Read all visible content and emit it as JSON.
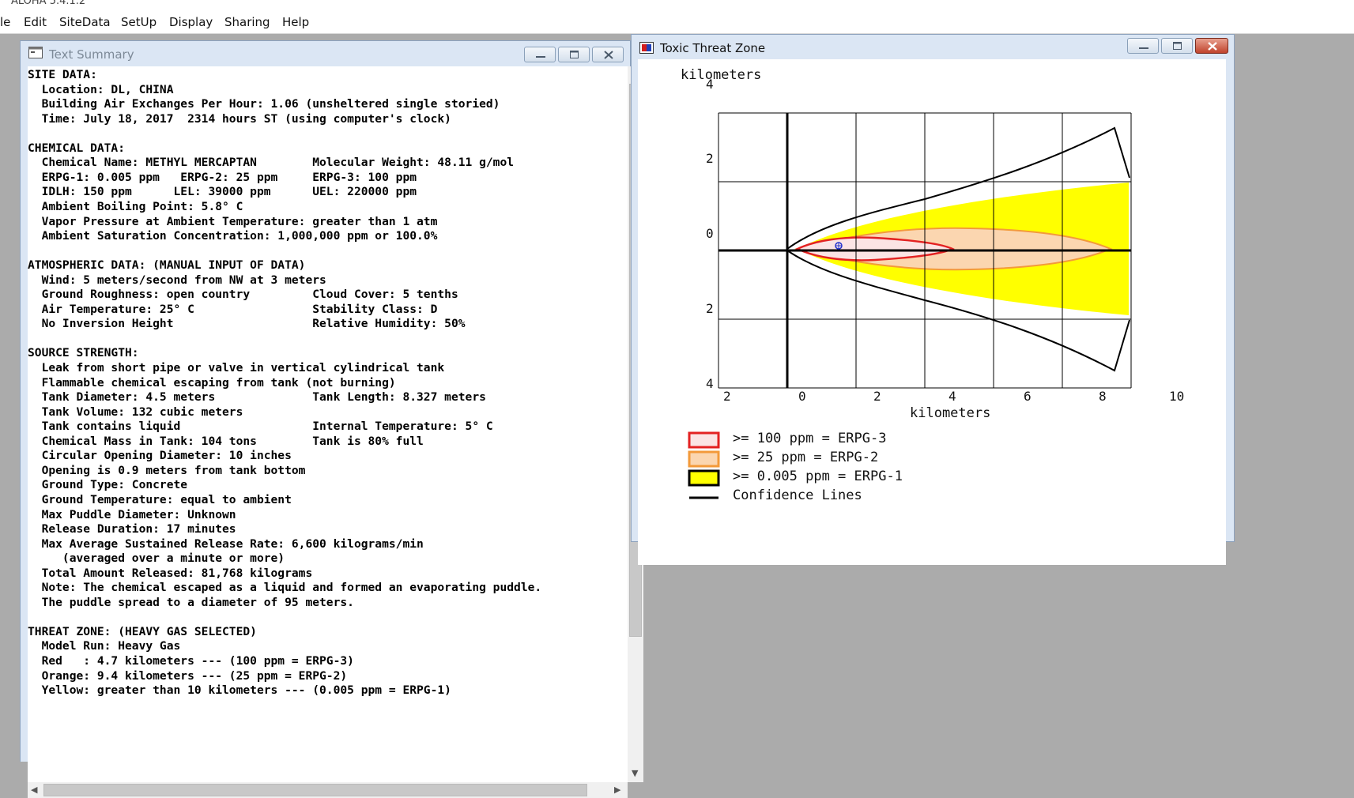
{
  "app": {
    "title": "ALOHA 5.4.1.2"
  },
  "menu": [
    "le",
    "Edit",
    "SiteData",
    "SetUp",
    "Display",
    "Sharing",
    "Help"
  ],
  "text_summary": {
    "title": "Text Summary",
    "lines": [
      "SITE DATA:",
      "  Location: DL, CHINA",
      "  Building Air Exchanges Per Hour: 1.06 (unsheltered single storied)",
      "  Time: July 18, 2017  2314 hours ST (using computer's clock)",
      "",
      "CHEMICAL DATA:",
      "  Chemical Name: METHYL MERCAPTAN        Molecular Weight: 48.11 g/mol",
      "  ERPG-1: 0.005 ppm   ERPG-2: 25 ppm     ERPG-3: 100 ppm",
      "  IDLH: 150 ppm      LEL: 39000 ppm      UEL: 220000 ppm",
      "  Ambient Boiling Point: 5.8° C",
      "  Vapor Pressure at Ambient Temperature: greater than 1 atm",
      "  Ambient Saturation Concentration: 1,000,000 ppm or 100.0%",
      "",
      "ATMOSPHERIC DATA: (MANUAL INPUT OF DATA)",
      "  Wind: 5 meters/second from NW at 3 meters",
      "  Ground Roughness: open country         Cloud Cover: 5 tenths",
      "  Air Temperature: 25° C                 Stability Class: D",
      "  No Inversion Height                    Relative Humidity: 50%",
      "",
      "SOURCE STRENGTH:",
      "  Leak from short pipe or valve in vertical cylindrical tank",
      "  Flammable chemical escaping from tank (not burning)",
      "  Tank Diameter: 4.5 meters              Tank Length: 8.327 meters",
      "  Tank Volume: 132 cubic meters",
      "  Tank contains liquid                   Internal Temperature: 5° C",
      "  Chemical Mass in Tank: 104 tons        Tank is 80% full",
      "  Circular Opening Diameter: 10 inches",
      "  Opening is 0.9 meters from tank bottom",
      "  Ground Type: Concrete",
      "  Ground Temperature: equal to ambient",
      "  Max Puddle Diameter: Unknown",
      "  Release Duration: 17 minutes",
      "  Max Average Sustained Release Rate: 6,600 kilograms/min",
      "     (averaged over a minute or more)",
      "  Total Amount Released: 81,768 kilograms",
      "  Note: The chemical escaped as a liquid and formed an evaporating puddle.",
      "  The puddle spread to a diameter of 95 meters.",
      "",
      "THREAT ZONE: (HEAVY GAS SELECTED)",
      "  Model Run: Heavy Gas",
      "  Red   : 4.7 kilometers --- (100 ppm = ERPG-3)",
      "  Orange: 9.4 kilometers --- (25 ppm = ERPG-2)",
      "  Yellow: greater than 10 kilometers --- (0.005 ppm = ERPG-1)"
    ]
  },
  "threat_zone": {
    "title": "Toxic Threat Zone",
    "ylabel": "kilometers",
    "xlabel": "kilometers",
    "x_ticks": [
      "2",
      "0",
      "2",
      "4",
      "6",
      "8",
      "10"
    ],
    "y_ticks": [
      "4",
      "2",
      "0",
      "2",
      "4"
    ],
    "legend": [
      {
        "label": ">= 100 ppm = ERPG-3",
        "color": "#e32222",
        "fill": "#fbe4e4"
      },
      {
        "label": ">= 25 ppm = ERPG-2",
        "color": "#f39a3a",
        "fill": "#fbd6b0"
      },
      {
        "label": ">= 0.005 ppm = ERPG-1",
        "color": "#000000",
        "fill": "#ffff00"
      },
      {
        "label": "Confidence Lines",
        "color": "#000000",
        "fill": "none"
      }
    ],
    "zones": {
      "red_km": 4.7,
      "orange_km": 9.4,
      "yellow": "greater than 10 kilometers"
    }
  }
}
